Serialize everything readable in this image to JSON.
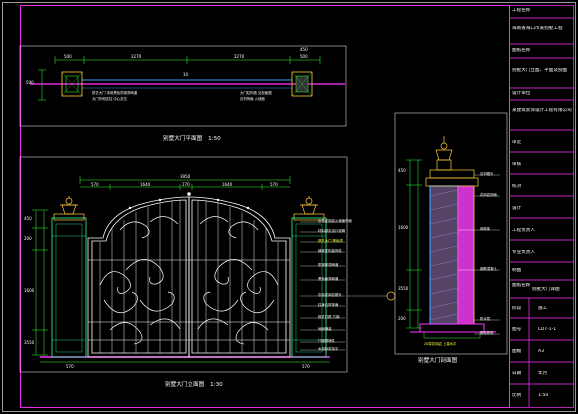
{
  "colors": {
    "background": "#000000",
    "frame": "#ff33ff",
    "dimension": "#33ff33",
    "ironwork": "#ffffff",
    "pillar": "#33ff99",
    "cap_lamp": "#ffcc33",
    "section_line": "#3399ff",
    "section_fill": "#cc33cc",
    "ground": "#ff33ff",
    "text": "#ffffff",
    "notes_yellow": "#ffff33"
  },
  "title_block": {
    "rows": [
      "工程名称",
      "海南省海口市某别墅工程",
      "图纸名称",
      "别墅大门立面、平面及剖面",
      "设计单位",
      "某建筑装饰设计工程有限公司",
      "审定",
      "审核",
      "校对",
      "设计",
      "工程负责人",
      "专业负责人",
      "制图",
      "图纸名称"
    ],
    "drawing_title": "别墅大门详图",
    "fields": [
      {
        "label": "阶段",
        "value": "施工"
      },
      {
        "label": "图号",
        "value": "LD7-1-1"
      },
      {
        "label": "图幅",
        "value": "A3"
      },
      {
        "label": "日期",
        "value": "年月"
      },
      {
        "label": "比例",
        "value": "1:50"
      }
    ]
  },
  "captions": {
    "plan": {
      "text": "别墅大门平面图",
      "scale": "1:50"
    },
    "elevation": {
      "text": "别墅大门立面图",
      "scale": "1:30"
    },
    "section": {
      "text": "别墅大门剖面图",
      "scale": ""
    }
  },
  "plan_dims": {
    "top": [
      "500",
      "2270",
      "2270",
      "500"
    ],
    "left": "500",
    "right_top": "450",
    "center": "10",
    "note_left": "铁艺大门 采用黑色防锈漆两道",
    "note_left2": "大门外侧支柱 中心定位",
    "note_right": "大门柱构造 见剖面图",
    "note_right2": "石材饰面 火烧面"
  },
  "elev_dims": {
    "top_total": "3950",
    "top_segments": [
      "570",
      "1640",
      "170",
      "1640",
      "570"
    ],
    "bottom_left": "570",
    "bottom_right": "570",
    "left": [
      "450",
      "200",
      "1600",
      "3550"
    ],
    "notes_right": [
      "灰色花岗岩火烧面饰面",
      "材料详见设计说明",
      "铁艺大门 黑色漆",
      "铸铁花形装饰件",
      "防锈底漆两道",
      "黑色面漆两道",
      "灰色花岗岩帽头",
      "柱身石材饰面",
      "铁艺门框 方钢",
      "地面铺装",
      "门轴预埋件",
      "水泥砂浆找平"
    ]
  },
  "section_dims": {
    "left": [
      "450",
      "1600",
      "3550",
      "200"
    ],
    "notes": [
      "石材帽头",
      "花岗岩饰面",
      "砖砌体",
      "钢筋混凝土",
      "防水层",
      "基础垫层"
    ],
    "bottom": "20厚花岗岩 上端水平"
  }
}
